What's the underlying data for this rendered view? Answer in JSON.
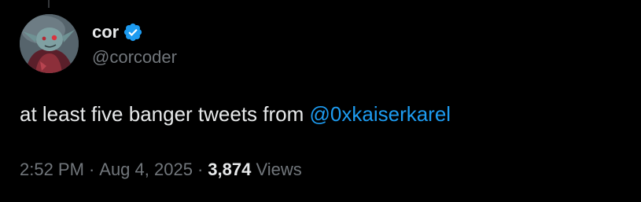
{
  "tweet": {
    "author": {
      "display_name": "cor",
      "handle": "@corcoder",
      "verified_icon": "verified-badge-icon",
      "avatar_icon": "avatar-image"
    },
    "text_prefix": "at least five banger tweets from ",
    "mention": "@0xkaiserkarel",
    "time": "2:52 PM",
    "separator": "·",
    "date": "Aug 4, 2025",
    "views_count": "3,874",
    "views_label": "Views"
  },
  "colors": {
    "background": "#000000",
    "text": "#e7e9ea",
    "muted": "#71767b",
    "accent": "#1d9bf0"
  }
}
